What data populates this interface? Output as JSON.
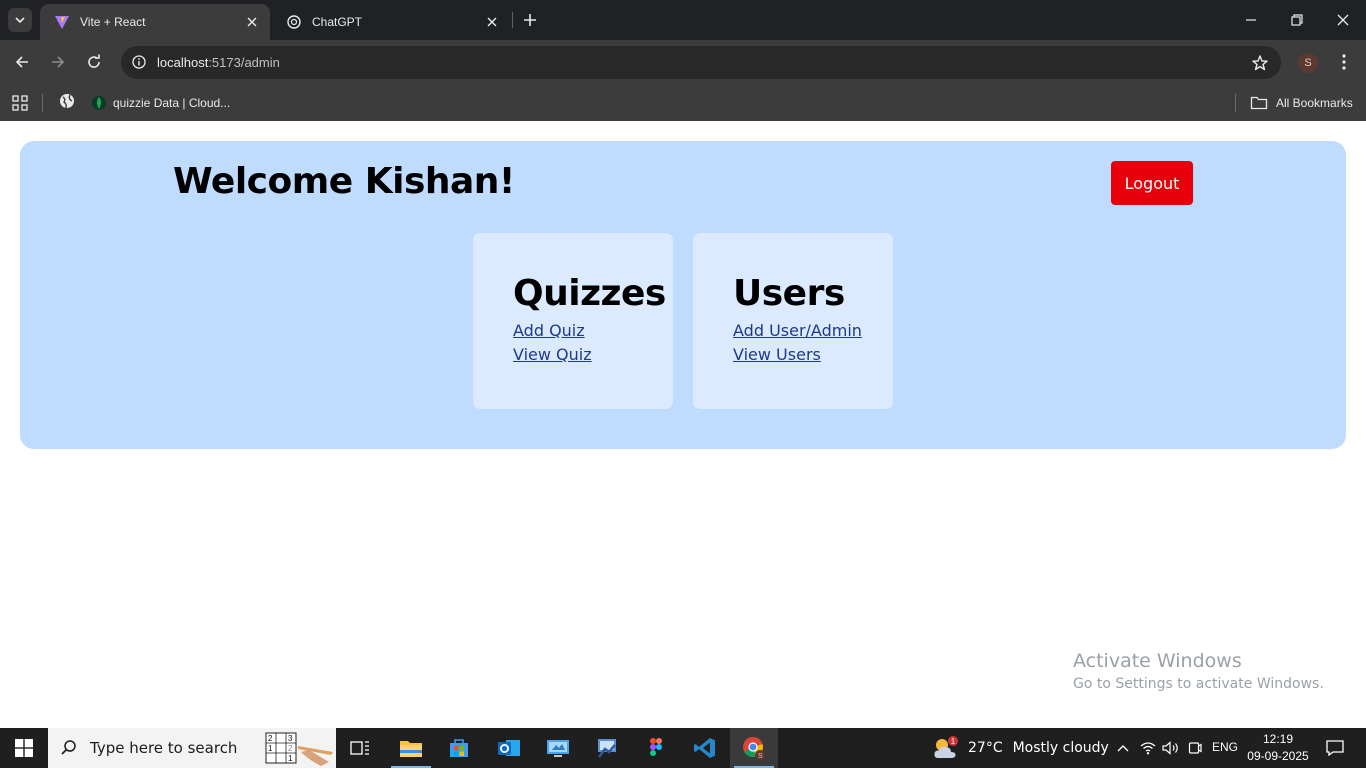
{
  "browser": {
    "tabs": [
      {
        "title": "Vite + React",
        "active": true
      },
      {
        "title": "ChatGPT",
        "active": false
      }
    ],
    "url_host": "localhost",
    "url_path": ":5173/admin",
    "profile_initial": "S",
    "bookmarks": [
      {
        "label": "quizzie Data | Cloud..."
      }
    ],
    "all_bookmarks_label": "All Bookmarks"
  },
  "page": {
    "welcome": "Welcome Kishan!",
    "logout_label": "Logout",
    "cards": [
      {
        "title": "Quizzes",
        "links": [
          "Add Quiz",
          "View Quiz"
        ]
      },
      {
        "title": "Users",
        "links": [
          "Add User/Admin",
          "View Users"
        ]
      }
    ],
    "colors": {
      "panel": "#bfdbfe",
      "card": "#dbeafe",
      "logout": "#e7000b",
      "link": "#1e3a8a"
    }
  },
  "watermark": {
    "line1": "Activate Windows",
    "line2": "Go to Settings to activate Windows."
  },
  "taskbar": {
    "search_placeholder": "Type here to search",
    "weather": {
      "temp": "27°C",
      "condition": "Mostly cloudy",
      "badge": "1"
    },
    "language": "ENG",
    "time": "12:19",
    "date": "09-09-2025",
    "pinned_apps": [
      "task-view",
      "file-explorer",
      "microsoft-store",
      "outlook",
      "remote-desktop",
      "control-panel",
      "figma",
      "vs-code",
      "chrome"
    ]
  }
}
